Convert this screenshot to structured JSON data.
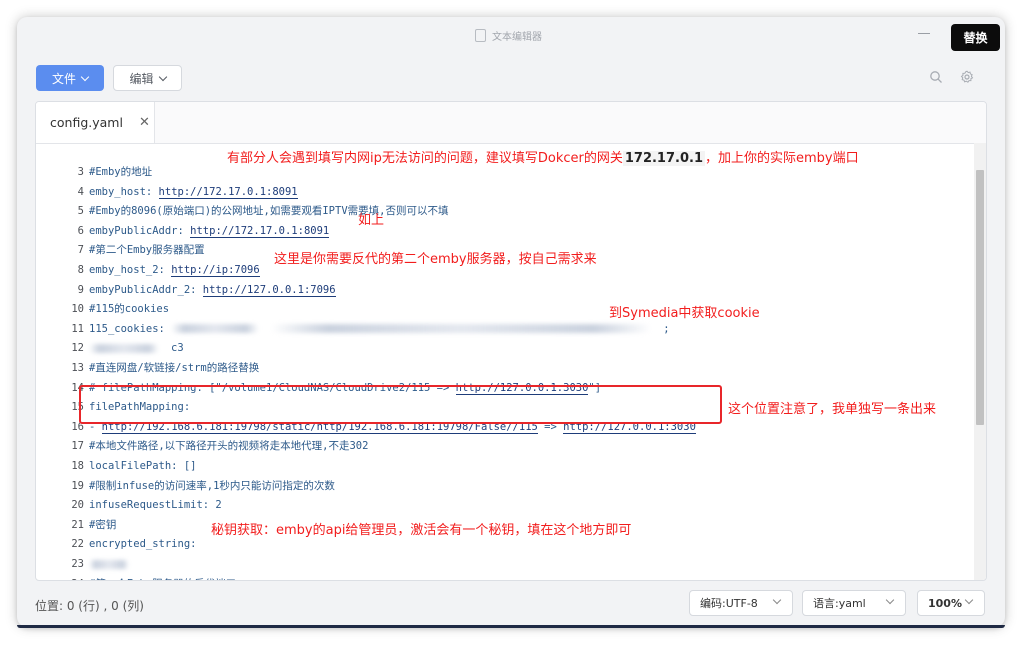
{
  "window": {
    "title": "文本编辑器",
    "replace_label": "替换"
  },
  "toolbar": {
    "file_label": "文件",
    "edit_label": "编辑"
  },
  "tab": {
    "name": "config.yaml"
  },
  "code_lines": [
    {
      "num": "3",
      "text": "#Emby的地址"
    },
    {
      "num": "4",
      "text": "emby_host: ",
      "url": "http://172.17.0.1:8091"
    },
    {
      "num": "5",
      "text": "#Emby的8096(原始端口)的公网地址,如需要观看IPTV需要填,否则可以不填"
    },
    {
      "num": "6",
      "text": "embyPublicAddr: ",
      "url": "http://172.17.0.1:8091"
    },
    {
      "num": "7",
      "text": "#第二个Emby服务器配置"
    },
    {
      "num": "8",
      "text": "emby_host_2: ",
      "url": "http://ip:7096"
    },
    {
      "num": "9",
      "text": "embyPublicAddr_2: ",
      "url": "http://127.0.0.1:7096"
    },
    {
      "num": "10",
      "text": "#115的cookies"
    },
    {
      "num": "11",
      "text": "115_cookies: ",
      "tail": ";"
    },
    {
      "num": "12",
      "text": "",
      "tail": "c3"
    },
    {
      "num": "13",
      "text": "#直连网盘/软链接/strm的路径替换"
    },
    {
      "num": "14",
      "text": "# filePathMapping: [\"/volume1/CloudNAS/CloudDrive2/115 => ",
      "url": "http://127.0.0.1:3030",
      "tail": "\"]"
    },
    {
      "num": "15",
      "text": "filePathMapping:"
    },
    {
      "num": "16",
      "text": "- ",
      "url": "http://192.168.6.181:19798/static/http/192.168.6.181:19798/False//115",
      "mid": " => ",
      "url2": "http://127.0.0.1:3030"
    },
    {
      "num": "17",
      "text": "#本地文件路径,以下路径开头的视频将走本地代理,不走302"
    },
    {
      "num": "18",
      "text": "localFilePath: []"
    },
    {
      "num": "19",
      "text": "#限制infuse的访问速率,1秒内只能访问指定的次数"
    },
    {
      "num": "20",
      "text": "infuseRequestLimit: 2"
    },
    {
      "num": "21",
      "text": "#密钥"
    },
    {
      "num": "22",
      "text": "encrypted_string: "
    },
    {
      "num": "23",
      "text": ""
    },
    {
      "num": "24",
      "text": "#第一个Emby服务器的反代端口"
    }
  ],
  "annotations": {
    "a1": "有部分人会遇到填写内网ip无法访问的问题，建议填写Dokcer的网关",
    "a1_ip": "172.17.0.1",
    "a1_tail": "，加上你的实际emby端口",
    "a2": "如上",
    "a3": "这里是你需要反代的第二个emby服务器，按自己需求来",
    "a4": "到Symedia中获取cookie",
    "a5": "这个位置注意了，我单独写一条出来",
    "a6": "秘钥获取：emby的api给管理员，激活会有一个秘钥，填在这个地方即可"
  },
  "status": {
    "position": "位置: 0 (行) , 0 (列)",
    "encoding_label": "编码: ",
    "encoding_value": "UTF-8",
    "language_label": "语言: ",
    "language_value": "yaml",
    "zoom": "100%"
  },
  "colors": {
    "accent": "#5b8def",
    "annotation": "#f21d1d",
    "replace_bg": "#0c0c0c"
  }
}
